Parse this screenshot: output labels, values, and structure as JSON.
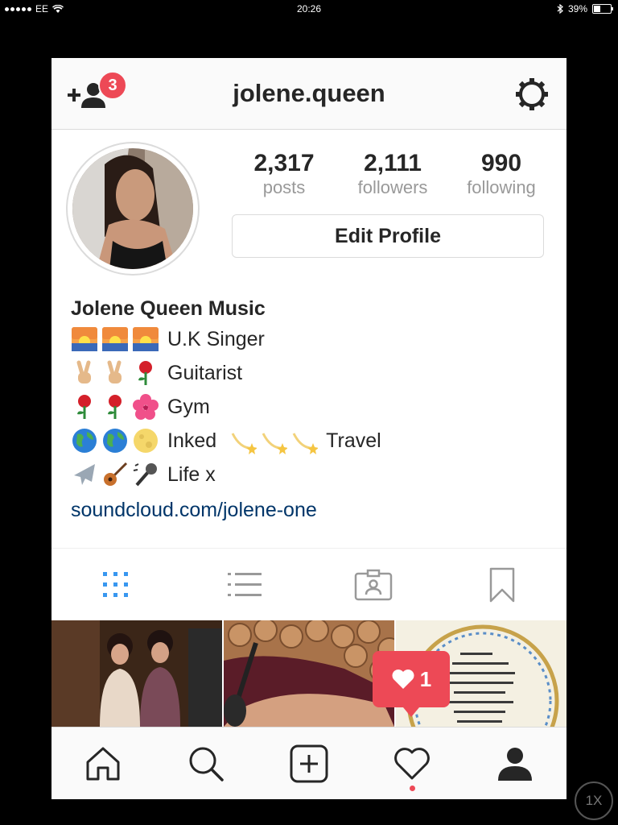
{
  "status": {
    "carrier": "EE",
    "time": "20:26",
    "battery": "39%"
  },
  "header": {
    "username": "jolene.queen",
    "notification_count": "3"
  },
  "profile": {
    "stats": [
      {
        "value": "2,317",
        "label": "posts"
      },
      {
        "value": "2,111",
        "label": "followers"
      },
      {
        "value": "990",
        "label": "following"
      }
    ],
    "edit_label": "Edit Profile"
  },
  "bio": {
    "name": "Jolene Queen Music",
    "lines": [
      {
        "emojis": [
          "sunrise-emoji",
          "sunrise-emoji",
          "sunrise-emoji"
        ],
        "text": "U.K Singer"
      },
      {
        "emojis": [
          "peace-hand-emoji",
          "peace-hand-emoji",
          "rose-emoji"
        ],
        "text": "Guitarist"
      },
      {
        "emojis": [
          "rose-emoji",
          "rose-emoji",
          "hibiscus-emoji"
        ],
        "text": "Gym"
      },
      {
        "emojis": [
          "globe-emoji",
          "globe-emoji",
          "moon-emoji"
        ],
        "text": "Inked",
        "trailing_emojis": [
          "shooting-star-emoji",
          "shooting-star-emoji",
          "shooting-star-emoji"
        ],
        "trailing_text": "Travel"
      },
      {
        "emojis": [
          "airplane-emoji",
          "guitar-emoji",
          "microphone-emoji"
        ],
        "text": "Life x"
      }
    ],
    "link": "soundcloud.com/jolene-one"
  },
  "activity_popup": {
    "count": "1"
  },
  "zoom": {
    "label": "1X"
  },
  "colors": {
    "accent": "#3897f0",
    "badge": "#ed4956",
    "link": "#003569"
  }
}
